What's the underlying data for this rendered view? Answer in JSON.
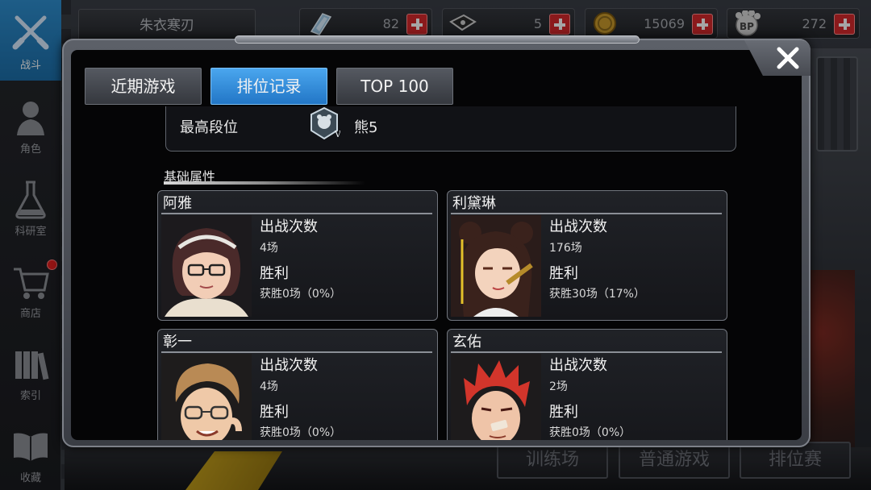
{
  "player": {
    "name": "朱衣寒刃"
  },
  "currencies": [
    {
      "icon": "crystal-icon",
      "value": "82"
    },
    {
      "icon": "ticket-icon",
      "value": "5"
    },
    {
      "icon": "gold-coin-icon",
      "value": "15069"
    },
    {
      "icon": "bp-paw-icon",
      "value": "272"
    }
  ],
  "sidebar": {
    "items": [
      {
        "label": "战斗",
        "icon": "crossed-swords-icon"
      },
      {
        "label": "角色",
        "icon": "character-icon"
      },
      {
        "label": "科研室",
        "icon": "flask-icon"
      },
      {
        "label": "商店",
        "icon": "shopping-cart-icon"
      },
      {
        "label": "索引",
        "icon": "books-icon"
      },
      {
        "label": "收藏",
        "icon": "open-book-icon"
      }
    ]
  },
  "background_modes": [
    "训练场",
    "普通游戏",
    "排位赛"
  ],
  "tabs": [
    {
      "label": "近期游戏",
      "active": false
    },
    {
      "label": "排位记录",
      "active": true
    },
    {
      "label": "TOP 100",
      "active": false
    }
  ],
  "rank": {
    "label": "最高段位",
    "value": "熊5",
    "icon": "bear-rank-badge-icon"
  },
  "section": {
    "title": "基础属性"
  },
  "characters": [
    {
      "name": "阿雅",
      "games_label": "出战次数",
      "games": "4场",
      "wins_label": "胜利",
      "wins": "获胜0场（0%）"
    },
    {
      "name": "利黛琳",
      "games_label": "出战次数",
      "games": "176场",
      "wins_label": "胜利",
      "wins": "获胜30场（17%）"
    },
    {
      "name": "彰一",
      "games_label": "出战次数",
      "games": "4场",
      "wins_label": "胜利",
      "wins": "获胜0场（0%）"
    },
    {
      "name": "玄佑",
      "games_label": "出战次数",
      "games": "2场",
      "wins_label": "胜利",
      "wins": "获胜0场（0%）"
    }
  ],
  "colors": {
    "active_tab": "#2e8ad8",
    "sidebar_active": "#2380c2",
    "add_button": "#d6282b"
  }
}
